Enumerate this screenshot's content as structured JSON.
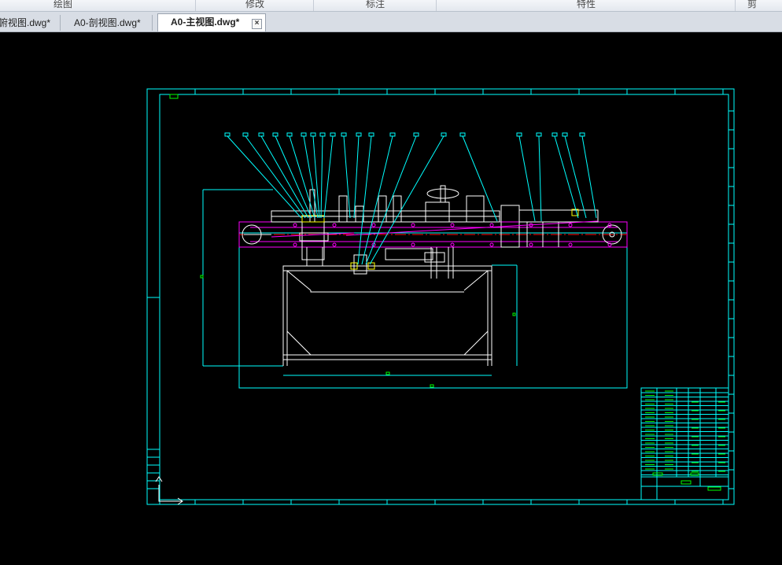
{
  "ribbon": {
    "panels": [
      "绘图",
      "修改",
      "标注",
      "特性",
      "剪"
    ]
  },
  "tabs": [
    {
      "label": "俯视图.dwg*",
      "active": false
    },
    {
      "label": "A0-剖视图.dwg*",
      "active": false
    },
    {
      "label": "A0-主视图.dwg*",
      "active": true
    }
  ],
  "tab_close_symbol": "×",
  "drawing": {
    "background": "#000000",
    "colors": {
      "frame": "#00ffff",
      "geometry": "#ffffff",
      "centerline": "#ff0000",
      "highlight": "#ff00ff",
      "dimension_text": "#00ff00",
      "note": "#ffff00"
    }
  }
}
